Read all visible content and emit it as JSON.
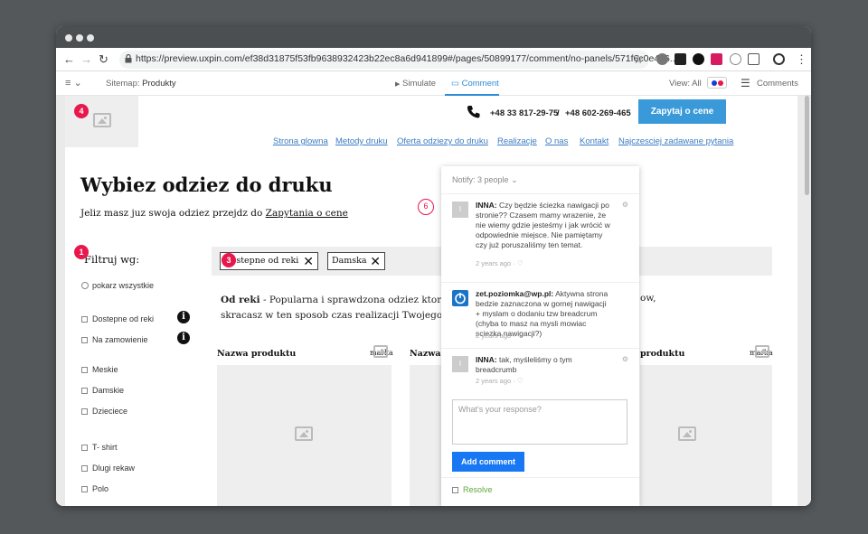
{
  "browser": {
    "url": "https://preview.uxpin.com/ef38d31875f53fb9638932423b22ec8a6d941899#/pages/50899177/comment/no-panels/571f6c0e486...",
    "back_icon": "←",
    "forward_icon": "→",
    "reload_icon": "↻",
    "star_icon": "☆",
    "menu_icon": "⋮"
  },
  "toolbar": {
    "sitemap_label": "Sitemap:",
    "sitemap_value": "Produkty",
    "simulate": "Simulate",
    "comment": "Comment",
    "view_label": "View: All",
    "comments": "Comments"
  },
  "header": {
    "phone1": "+48 33 817-29-75",
    "separator": "/",
    "phone2": "+48 602-269-465",
    "cta": "Zapytaj o cene",
    "menu": [
      "Strona glowna",
      "Metody druku",
      "Oferta odziezy do druku",
      "Realizacje",
      "O nas",
      "Kontakt",
      "Najczesciej zadawane pytania"
    ]
  },
  "markers": {
    "m1": "1",
    "m3": "3",
    "m4": "4",
    "m6": "6"
  },
  "main": {
    "title": "Wybiez odziez do druku",
    "subtitle_pre": "Jeliz masz juz swoja odziez przejdz do",
    "subtitle_link": "Zapytania o cene"
  },
  "filters": {
    "title": "Filtruj wg:",
    "show_all": "pokarz wszystkie",
    "items": [
      "Dostepne od reki",
      "Na zamowienie",
      "Meskie",
      "Damskie",
      "Dzieciece",
      "T- shirt",
      "Dlugi rekaw",
      "Polo"
    ]
  },
  "tags": [
    "Dostepne od reki",
    "Damska"
  ],
  "description": {
    "bold": "Od reki",
    "line1": " - Popularna i sprawdzona odziez ktore mar",
    "line2": "skracasz w ten sposob czas realizacji Twojego zamo",
    "right": "ow,"
  },
  "products": {
    "title": "Nazwa produktu",
    "title_cut": "Nazwa",
    "brand": "marka",
    "brand_cut": "marka"
  },
  "comments_panel": {
    "notify": "Notify: 3 people",
    "items": [
      {
        "avatar": "I",
        "author": "INNA:",
        "text": "Czy będzie ściezka nawigacji po stronie?? Czasem mamy wrazenie, że nie wiemy gdzie jesteśmy i jak wrócić w odpowiednie miejsce. Nie pamiętamy czy już poruszaliśmy ten temat.",
        "time": "2 years ago"
      },
      {
        "avatar": "",
        "author": "zet.poziomka@wp.pl:",
        "text": "Aktywna strona bedzie zaznaczona w gornej nawigacji + myslam o dodaniu tzw breadcrum (chyba to masz na mysli mowiac sciezka nawigacji?)",
        "time": "2 years ago"
      },
      {
        "avatar": "I",
        "author": "INNA:",
        "text": "tak, myśleliśmy o tym breadcrumb",
        "time": "2 years ago"
      }
    ],
    "reply_placeholder": "What's your response?",
    "add_button": "Add comment",
    "resolve": "Resolve"
  },
  "colors": {
    "accent": "#2d8cd8",
    "marker": "#e8174c",
    "cta": "#3a9ad9",
    "add_button": "#1877f2",
    "resolve": "#5fa83d"
  }
}
